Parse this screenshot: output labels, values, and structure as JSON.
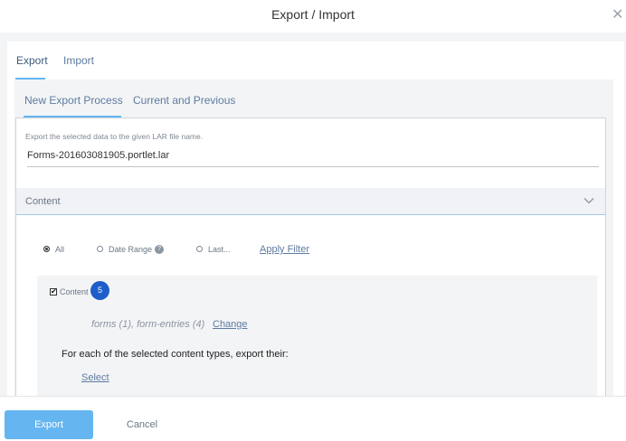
{
  "modal": {
    "title": "Export / Import",
    "close_icon": "close-icon"
  },
  "tabs": [
    {
      "label": "Export",
      "active": true
    },
    {
      "label": "Import",
      "active": false
    }
  ],
  "subtabs": [
    {
      "label": "New Export Process",
      "active": true
    },
    {
      "label": "Current and Previous",
      "active": false
    }
  ],
  "export_form": {
    "hint": "Export the selected data to the given LAR file name.",
    "lar_file_name": "Forms-201603081905.portlet.lar"
  },
  "content_section": {
    "title": "Content",
    "expanded": true,
    "date_options": [
      {
        "label": "All",
        "selected": true
      },
      {
        "label": "Date Range",
        "selected": false,
        "has_help": true
      },
      {
        "label": "Last...",
        "selected": false
      }
    ],
    "apply_filter_label": "Apply Filter",
    "content_checkbox": {
      "label": "Content",
      "checked": true,
      "count": "5"
    },
    "types_summary": "forms (1), form-entries (4)",
    "change_label": "Change",
    "export_their_text": "For each of the selected content types, export their:",
    "select_label": "Select"
  },
  "footer": {
    "export_label": "Export",
    "cancel_label": "Cancel"
  },
  "colors": {
    "accent": "#65b6f0",
    "badge": "#1e5ec8",
    "link": "#5e7ba1"
  }
}
